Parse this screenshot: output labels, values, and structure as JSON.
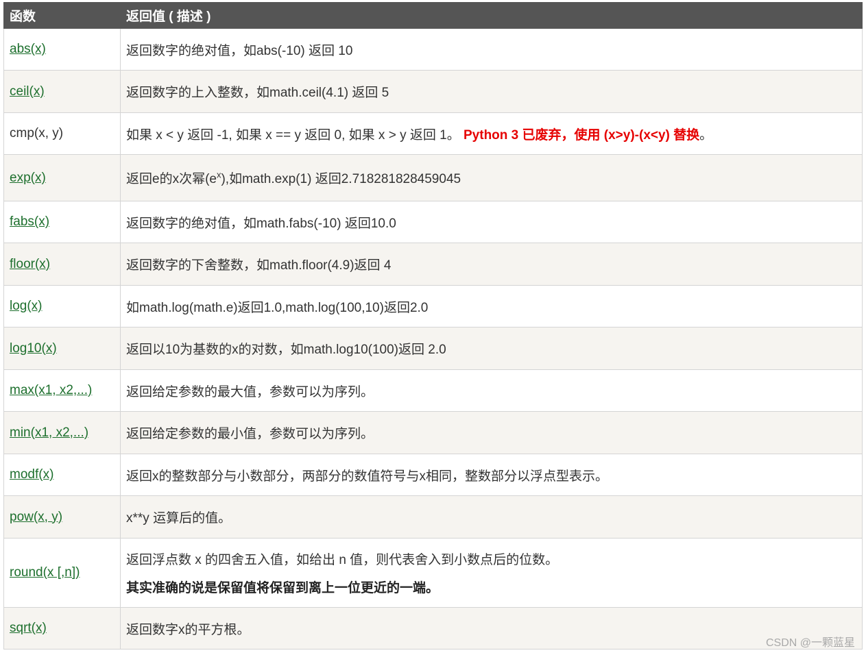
{
  "header": {
    "col_function": "函数",
    "col_return": "返回值 ( 描述 )"
  },
  "rows": {
    "abs": {
      "fn": "abs(x)",
      "desc": "返回数字的绝对值，如abs(-10) 返回 10"
    },
    "ceil": {
      "fn": "ceil(x)",
      "desc": "返回数字的上入整数，如math.ceil(4.1) 返回 5"
    },
    "cmp": {
      "fn": "cmp(x, y)",
      "desc": "如果 x < y 返回 -1, 如果 x == y 返回 0, 如果 x > y 返回 1。 ",
      "warning": "Python 3 已废弃，使用 (x>y)-(x<y) 替换",
      "tail": "。"
    },
    "exp": {
      "fn": "exp(x)",
      "desc_pre": "返回e的x次幂(e",
      "desc_sup": "x",
      "desc_post": "),如math.exp(1) 返回2.718281828459045"
    },
    "fabs": {
      "fn": "fabs(x)",
      "desc": "返回数字的绝对值，如math.fabs(-10) 返回10.0"
    },
    "floor": {
      "fn": "floor(x)",
      "desc": "返回数字的下舍整数，如math.floor(4.9)返回 4"
    },
    "log": {
      "fn": "log(x)",
      "desc": "如math.log(math.e)返回1.0,math.log(100,10)返回2.0"
    },
    "log10": {
      "fn": "log10(x)",
      "desc": "返回以10为基数的x的对数，如math.log10(100)返回 2.0"
    },
    "max": {
      "fn": "max(x1, x2,...)",
      "desc": "返回给定参数的最大值，参数可以为序列。"
    },
    "min": {
      "fn": "min(x1, x2,...)",
      "desc": "返回给定参数的最小值，参数可以为序列。"
    },
    "modf": {
      "fn": "modf(x)",
      "desc": "返回x的整数部分与小数部分，两部分的数值符号与x相同，整数部分以浮点型表示。"
    },
    "pow": {
      "fn": "pow(x, y)",
      "desc": "x**y 运算后的值。"
    },
    "round": {
      "fn": "round(x [,n])",
      "desc": "返回浮点数 x 的四舍五入值，如给出 n 值，则代表舍入到小数点后的位数。",
      "note": "其实准确的说是保留值将保留到离上一位更近的一端。"
    },
    "sqrt": {
      "fn": "sqrt(x)",
      "desc": "返回数字x的平方根。"
    }
  },
  "watermark": "CSDN @一颗蓝星",
  "colors": {
    "header_bg": "#555555",
    "link": "#1d6f2d",
    "warning": "#e60000",
    "stripe": "#f6f4f0"
  }
}
